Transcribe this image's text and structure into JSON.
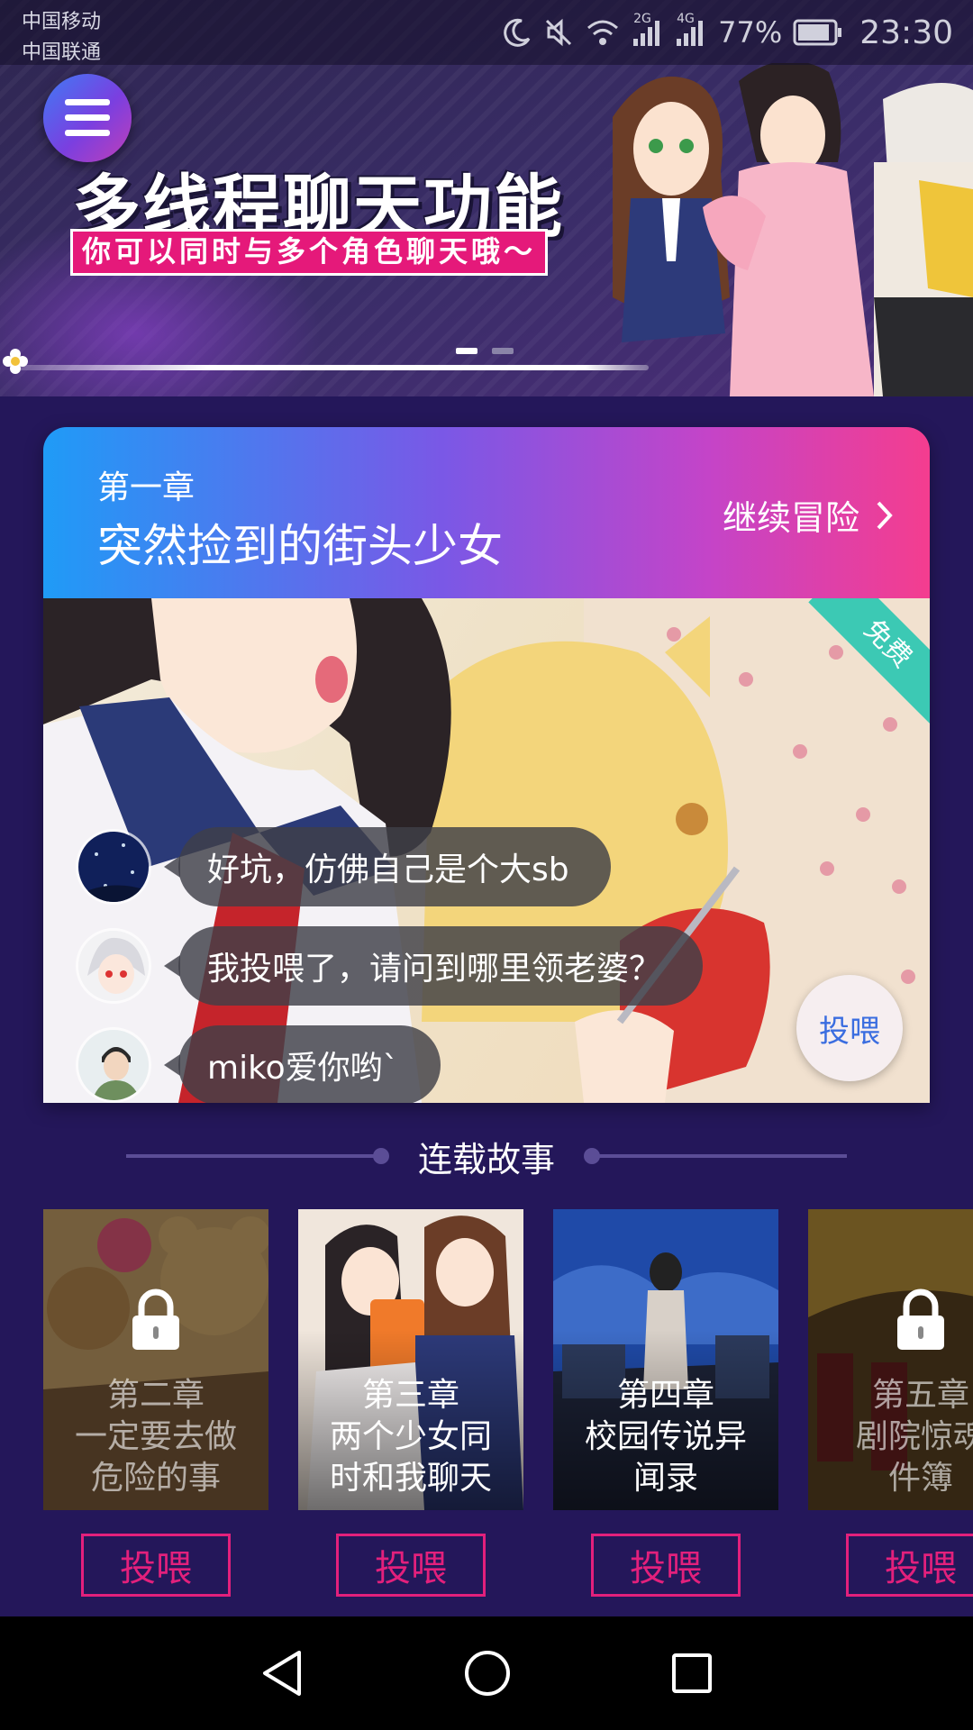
{
  "status_bar": {
    "carrier_1": "中国移动",
    "carrier_2": "中国联通",
    "network_1": "2G",
    "network_2": "4G",
    "battery": "77%",
    "time": "23:30",
    "icons": [
      "moon-icon",
      "mute-icon",
      "wifi-icon",
      "signal-icon",
      "signal-icon",
      "battery-icon"
    ]
  },
  "banner": {
    "title": "多线程聊天功能",
    "subtitle": "你可以同时与多个角色聊天哦～",
    "active_slide": 1,
    "slide_count": 2
  },
  "chapter": {
    "label": "第一章",
    "title": "突然捡到的街头少女",
    "continue_label": "继续冒险",
    "free_tag": "免费",
    "feed_button": "投喂",
    "messages": [
      {
        "text": "好坑，仿佛自己是个大sb",
        "avatar": "starry-night-avatar"
      },
      {
        "text": "我投喂了，请问到哪里领老婆？",
        "avatar": "white-hair-girl-avatar"
      },
      {
        "text": "miko爱你哟`",
        "avatar": "boy-in-jacket-avatar"
      }
    ]
  },
  "serial": {
    "title": "连载故事",
    "stories": [
      {
        "chapter": "第二章",
        "line1": "一定要去做",
        "line2": "危险的事",
        "locked": true,
        "button": "投喂"
      },
      {
        "chapter": "第三章",
        "line1": "两个少女同",
        "line2": "时和我聊天",
        "locked": false,
        "button": "投喂"
      },
      {
        "chapter": "第四章",
        "line1": "校园传说异",
        "line2": "闻录",
        "locked": false,
        "button": "投喂"
      },
      {
        "chapter": "第五章",
        "line1": "剧院惊魂",
        "line2": "件簿",
        "locked": true,
        "button": "投喂"
      }
    ]
  },
  "colors": {
    "background": "#24175a",
    "accent_pink": "#e3207c",
    "header_gradient_start": "#1f9bf7",
    "header_gradient_end": "#f43d8f"
  }
}
